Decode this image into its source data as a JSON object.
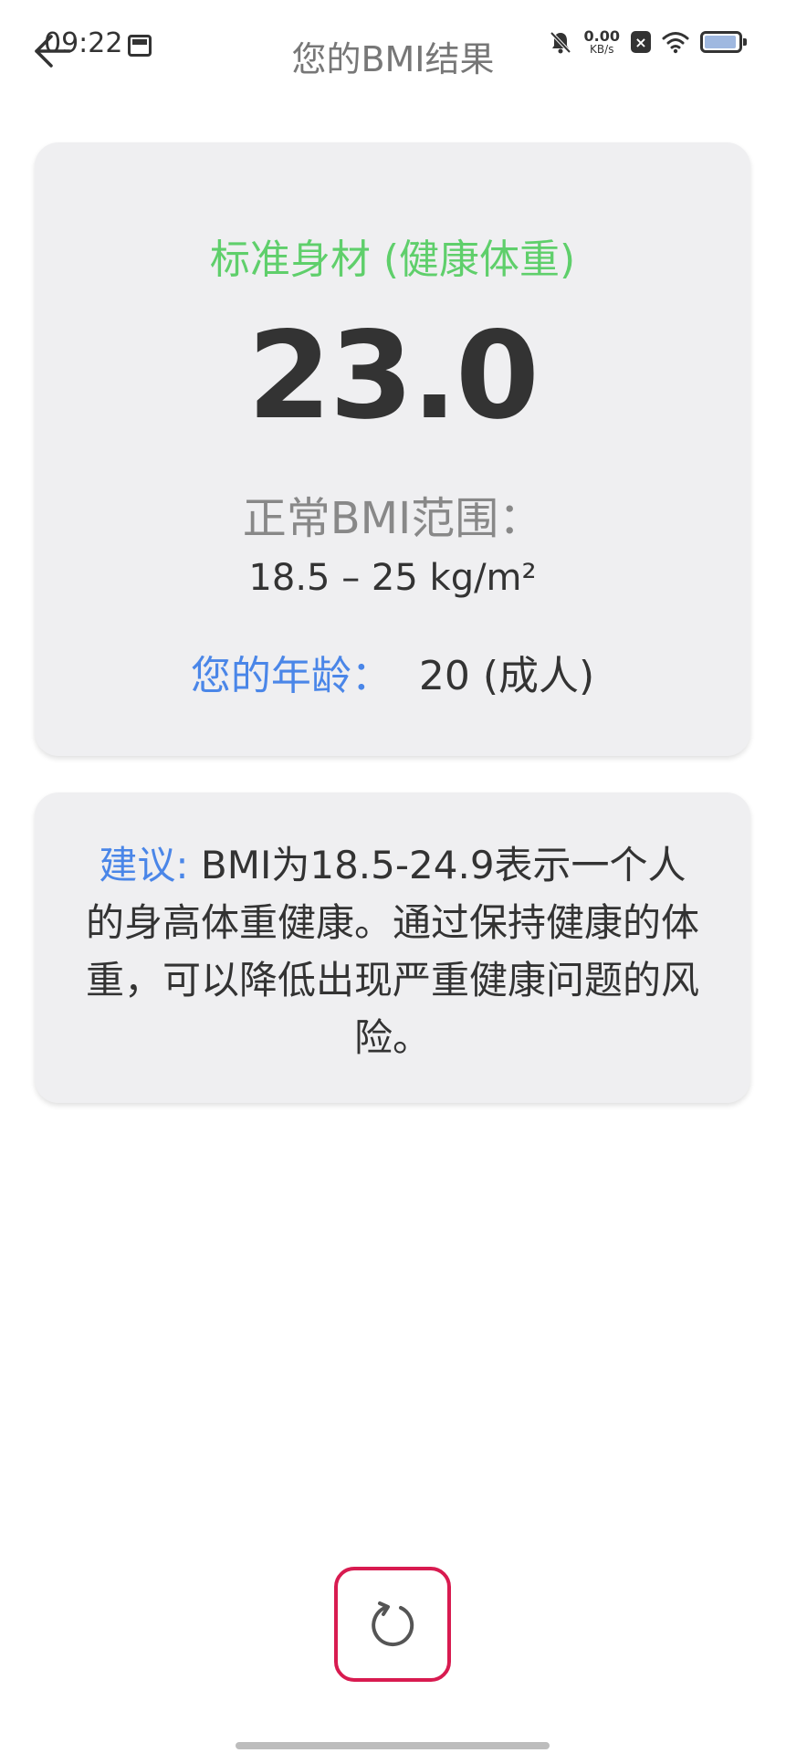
{
  "status_bar": {
    "time": "09:22",
    "net_speed_value": "0.00",
    "net_speed_unit": "KB/s",
    "battery_color": "#9fb8e0"
  },
  "app_bar": {
    "title": "您的BMI结果",
    "back_icon": "arrow-left-icon"
  },
  "result": {
    "status_label": "标准身材 (健康体重)",
    "status_color": "#5fcf6b",
    "bmi_value": "23.0",
    "range_title": "正常BMI范围：",
    "range_value": "18.5 – 25 kg/m²",
    "age_label": "您的年龄：",
    "age_value": "20 (成人)"
  },
  "advice": {
    "label": "建议:",
    "text": " BMI为18.5-24.9表示一个人的身高体重健康。通过保持健康的体重，可以降低出现严重健康问题的风险。"
  },
  "actions": {
    "refresh_icon": "refresh-icon",
    "refresh_border_color": "#d81b50"
  },
  "colors": {
    "accent_blue": "#4a86e8",
    "card_background": "#efeff1"
  }
}
